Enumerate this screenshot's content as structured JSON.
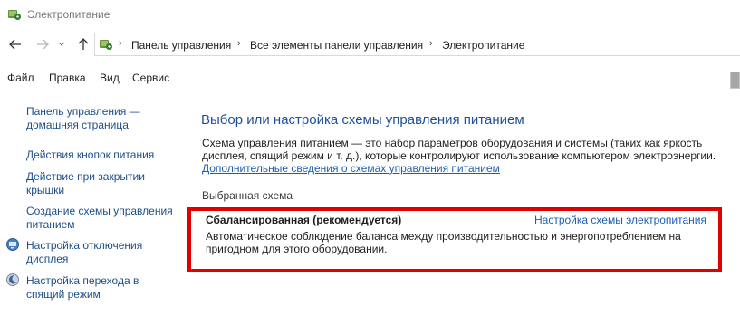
{
  "window": {
    "title": "Электропитание",
    "icon": "power-options-icon"
  },
  "nav": {
    "back_icon": "arrow-left-icon",
    "forward_icon": "arrow-right-icon",
    "recent_icon": "chevron-down-icon",
    "up_icon": "arrow-up-icon"
  },
  "address": {
    "crumbs": [
      "Панель управления",
      "Все элементы панели управления",
      "Электропитание"
    ]
  },
  "menu": {
    "items": [
      "Файл",
      "Правка",
      "Вид",
      "Сервис"
    ]
  },
  "sidebar": {
    "home_link": "Панель управления — домашняя страница",
    "items": [
      {
        "label": "Действия кнопок питания",
        "icon": ""
      },
      {
        "label": "Действие при закрытии крышки",
        "icon": ""
      },
      {
        "label": "Создание схемы управления питанием",
        "icon": ""
      },
      {
        "label": "Настройка отключения дисплея",
        "icon": "display-icon"
      },
      {
        "label": "Настройка перехода в спящий режим",
        "icon": "moon-icon"
      }
    ]
  },
  "main": {
    "title": "Выбор или настройка схемы управления питанием",
    "description": "Схема управления питанием — это набор параметров оборудования и системы (таких как яркость дисплея, спящий режим и т. д.), которые контролируют использование компьютером электроэнергии.",
    "more_info_link": "Дополнительные сведения о схемах управления питанием",
    "section_label": "Выбранная схема",
    "plan": {
      "name": "Сбалансированная (рекомендуется)",
      "settings_link": "Настройка схемы электропитания",
      "description": "Автоматическое соблюдение баланса между производительностью и энергопотреблением на пригодном для этого оборудовании."
    }
  },
  "colors": {
    "link": "#1a5fb4",
    "title": "#1e4f9a",
    "highlight": "#e00000"
  }
}
